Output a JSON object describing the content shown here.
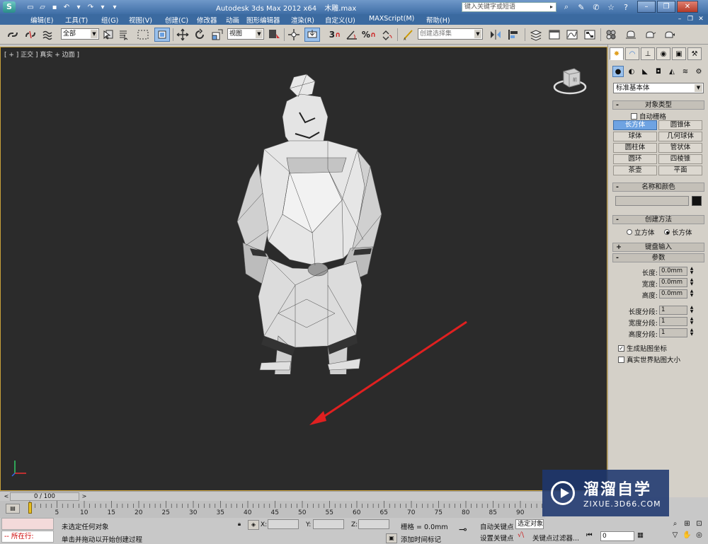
{
  "titlebar": {
    "app_name": "Autodesk 3ds Max  2012 x64",
    "file_name": "木雕.max",
    "search_placeholder": "键入关键字或短语"
  },
  "menubar": {
    "items": [
      "编辑(E)",
      "工具(T)",
      "组(G)",
      "视图(V)",
      "创建(C)",
      "修改器",
      "动画",
      "图形编辑器",
      "渲染(R)",
      "自定义(U)",
      "MAXScript(M)",
      "帮助(H)"
    ]
  },
  "toolbar": {
    "selection_filter": "全部",
    "reference_coord": "视图",
    "named_selection": "创建选择集",
    "snap_3": "3",
    "snap_percent": "%",
    "snap_angle": "A"
  },
  "viewport": {
    "label": "[ + ] 正交 ] 真实 + 边面 ]",
    "viewcube_label": "前"
  },
  "command_panel": {
    "category_dropdown": "标准基本体",
    "object_type": {
      "title": "对象类型",
      "autogrid_label": "自动栅格",
      "buttons": [
        "长方体",
        "圆锥体",
        "球体",
        "几何球体",
        "圆柱体",
        "管状体",
        "圆环",
        "四棱锥",
        "茶壶",
        "平面"
      ],
      "active": "长方体"
    },
    "name_color": {
      "title": "名称和颜色",
      "color": "#111111"
    },
    "creation_method": {
      "title": "创建方法",
      "options": [
        "立方体",
        "长方体"
      ],
      "selected": "长方体"
    },
    "keyboard_entry": {
      "title": "键盘输入"
    },
    "parameters": {
      "title": "参数",
      "rows": [
        {
          "label": "长度:",
          "value": "0.0mm"
        },
        {
          "label": "宽度:",
          "value": "0.0mm"
        },
        {
          "label": "高度:",
          "value": "0.0mm"
        }
      ],
      "segments": [
        {
          "label": "长度分段:",
          "value": "1"
        },
        {
          "label": "宽度分段:",
          "value": "1"
        },
        {
          "label": "高度分段:",
          "value": "1"
        }
      ],
      "gen_mapping": {
        "label": "生成贴图坐标",
        "checked": true
      },
      "real_world": {
        "label": "真实世界贴图大小",
        "checked": false
      }
    }
  },
  "timeline": {
    "frame_counter": "0 / 100",
    "ticks": [
      "0",
      "5",
      "10",
      "15",
      "20",
      "25",
      "30",
      "35",
      "40",
      "45",
      "50",
      "55",
      "60",
      "65",
      "70",
      "75",
      "80",
      "85",
      "90"
    ]
  },
  "statusbar": {
    "listener_text": "所在行:",
    "status_line1": "未选定任何对象",
    "status_line2": "单击并拖动以开始创建过程",
    "x_label": "X:",
    "y_label": "Y:",
    "z_label": "Z:",
    "grid_text": "栅格 = 0.0mm",
    "add_time_tag": "添加时间标记",
    "auto_key": "自动关键点",
    "selected_dropdown": "选定对象",
    "set_key": "设置关键点",
    "key_filters": "关键点过滤器...",
    "frame_field": "0"
  },
  "watermark": {
    "title": "溜溜自学",
    "url": "ZIXUE.3D66.COM"
  },
  "colors": {
    "title_blue": "#3f6ea6",
    "viewport_bg": "#2b2b2b",
    "viewport_border": "#c9a13b",
    "active_button": "#6ea3e2",
    "arrow_red": "#e02020"
  }
}
